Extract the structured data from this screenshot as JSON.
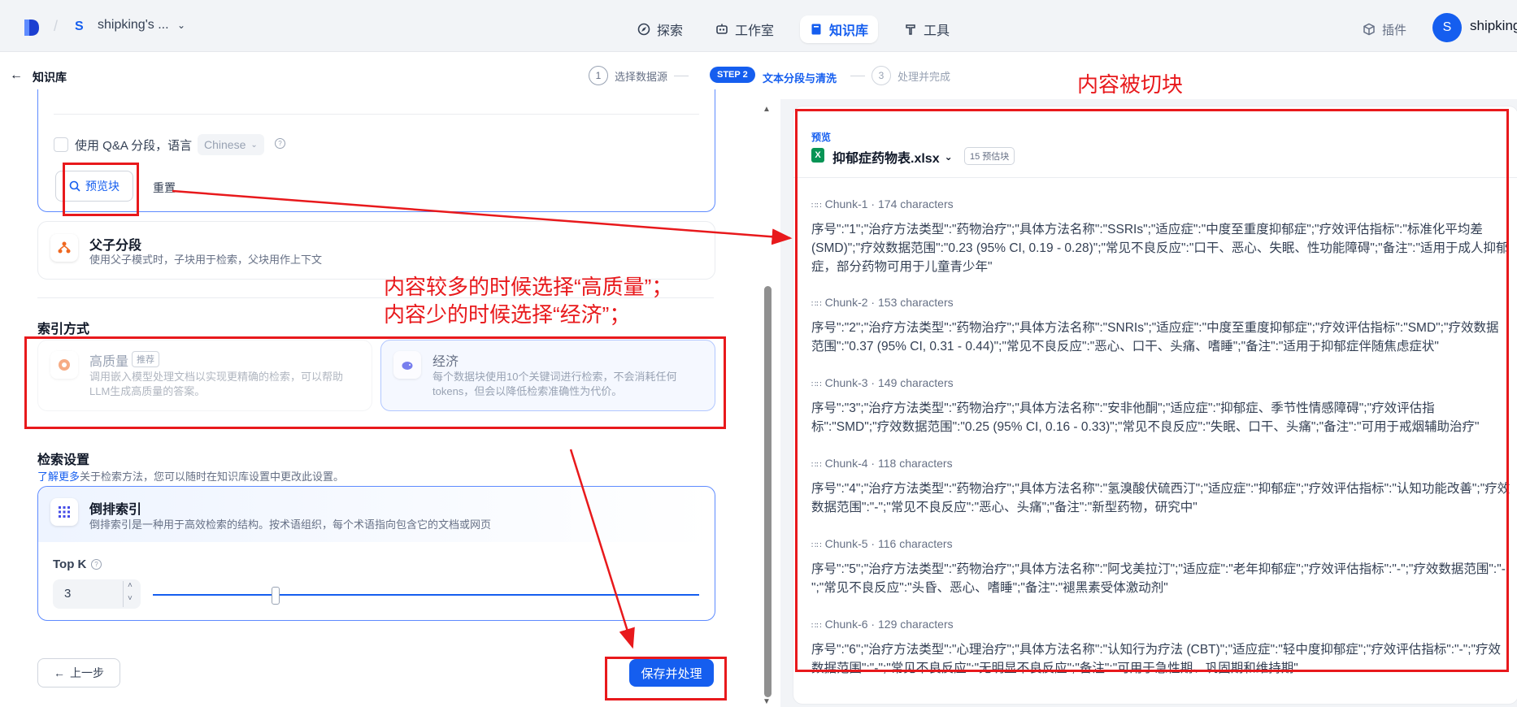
{
  "topbar": {
    "workspace_initial": "S",
    "workspace_name": "shipking's ...",
    "nav": [
      {
        "label": "探索",
        "icon": "explore-icon"
      },
      {
        "label": "工作室",
        "icon": "robot-icon"
      },
      {
        "label": "知识库",
        "icon": "book-icon",
        "active": true
      },
      {
        "label": "工具",
        "icon": "hammer-icon"
      }
    ],
    "plugin_label": "插件",
    "user_initial": "S",
    "user_name": "shipking"
  },
  "subheader": {
    "back_label": "知识库",
    "steps": [
      {
        "num": "1",
        "label": "选择数据源"
      },
      {
        "num": "STEP 2",
        "label": "文本分段与清洗",
        "active": true
      },
      {
        "num": "3",
        "label": "处理并完成"
      }
    ]
  },
  "segment": {
    "qa_label": "使用 Q&A 分段，语言",
    "language": "Chinese",
    "preview_button": "预览块",
    "reset_button": "重置",
    "parent_child_title": "父子分段",
    "parent_child_desc": "使用父子模式时，子块用于检索，父块用作上下文"
  },
  "index": {
    "title": "索引方式",
    "high_quality_title": "高质量",
    "high_quality_badge": "推荐",
    "high_quality_desc": "调用嵌入模型处理文档以实现更精确的检索，可以帮助LLM生成高质量的答案。",
    "economy_title": "经济",
    "economy_desc": "每个数据块使用10个关键词进行检索，不会消耗任何 tokens，但会以降低检索准确性为代价。"
  },
  "retrieval": {
    "title": "检索设置",
    "learn_more": "了解更多",
    "hint": "关于检索方法，您可以随时在知识库设置中更改此设置。",
    "inverted_title": "倒排索引",
    "inverted_desc": "倒排索引是一种用于高效检索的结构。按术语组织，每个术语指向包含它的文档或网页",
    "topk_label": "Top K",
    "topk_value": "3",
    "slider_fraction": 0.22
  },
  "footer": {
    "prev_button": "上一步",
    "save_button": "保存并处理"
  },
  "annotations": {
    "chunk_note": "内容被切块",
    "index_note_line1": "内容较多的时候选择“高质量”；",
    "index_note_line2": "内容少的时候选择“经济”；"
  },
  "preview": {
    "label": "预览",
    "file_name": "抑郁症药物表.xlsx",
    "estimate": "15 预估块",
    "chunks": [
      {
        "label": "Chunk-1",
        "chars": "174 characters",
        "text": "序号\":\"1\";\"治疗方法类型\":\"药物治疗\";\"具体方法名称\":\"SSRIs\";\"适应症\":\"中度至重度抑郁症\";\"疗效评估指标\":\"标准化平均差(SMD)\";\"疗效数据范围\":\"0.23 (95% CI, 0.19 - 0.28)\";\"常见不良反应\":\"口干、恶心、失眠、性功能障碍\";\"备注\":\"适用于成人抑郁症，部分药物可用于儿童青少年\""
      },
      {
        "label": "Chunk-2",
        "chars": "153 characters",
        "text": "序号\":\"2\";\"治疗方法类型\":\"药物治疗\";\"具体方法名称\":\"SNRIs\";\"适应症\":\"中度至重度抑郁症\";\"疗效评估指标\":\"SMD\";\"疗效数据范围\":\"0.37 (95% CI, 0.31 - 0.44)\";\"常见不良反应\":\"恶心、口干、头痛、嗜睡\";\"备注\":\"适用于抑郁症伴随焦虑症状\""
      },
      {
        "label": "Chunk-3",
        "chars": "149 characters",
        "text": "序号\":\"3\";\"治疗方法类型\":\"药物治疗\";\"具体方法名称\":\"安非他酮\";\"适应症\":\"抑郁症、季节性情感障碍\";\"疗效评估指标\":\"SMD\";\"疗效数据范围\":\"0.25 (95% CI, 0.16 - 0.33)\";\"常见不良反应\":\"失眠、口干、头痛\";\"备注\":\"可用于戒烟辅助治疗\""
      },
      {
        "label": "Chunk-4",
        "chars": "118 characters",
        "text": "序号\":\"4\";\"治疗方法类型\":\"药物治疗\";\"具体方法名称\":\"氢溴酸伏硫西汀\";\"适应症\":\"抑郁症\";\"疗效评估指标\":\"认知功能改善\";\"疗效数据范围\":\"-\";\"常见不良反应\":\"恶心、头痛\";\"备注\":\"新型药物，研究中\""
      },
      {
        "label": "Chunk-5",
        "chars": "116 characters",
        "text": "序号\":\"5\";\"治疗方法类型\":\"药物治疗\";\"具体方法名称\":\"阿戈美拉汀\";\"适应症\":\"老年抑郁症\";\"疗效评估指标\":\"-\";\"疗效数据范围\":\"-\";\"常见不良反应\":\"头昏、恶心、嗜睡\";\"备注\":\"褪黑素受体激动剂\""
      },
      {
        "label": "Chunk-6",
        "chars": "129 characters",
        "text": "序号\":\"6\";\"治疗方法类型\":\"心理治疗\";\"具体方法名称\":\"认知行为疗法 (CBT)\";\"适应症\":\"轻中度抑郁症\";\"疗效评估指标\":\"-\";\"疗效数据范围\":\"-\";\"常见不良反应\":\"无明显不良反应\";\"备注\":\"可用于急性期、巩固期和维持期\""
      }
    ]
  },
  "colors": {
    "primary": "#155eef",
    "annotation_red": "#e8191c"
  }
}
